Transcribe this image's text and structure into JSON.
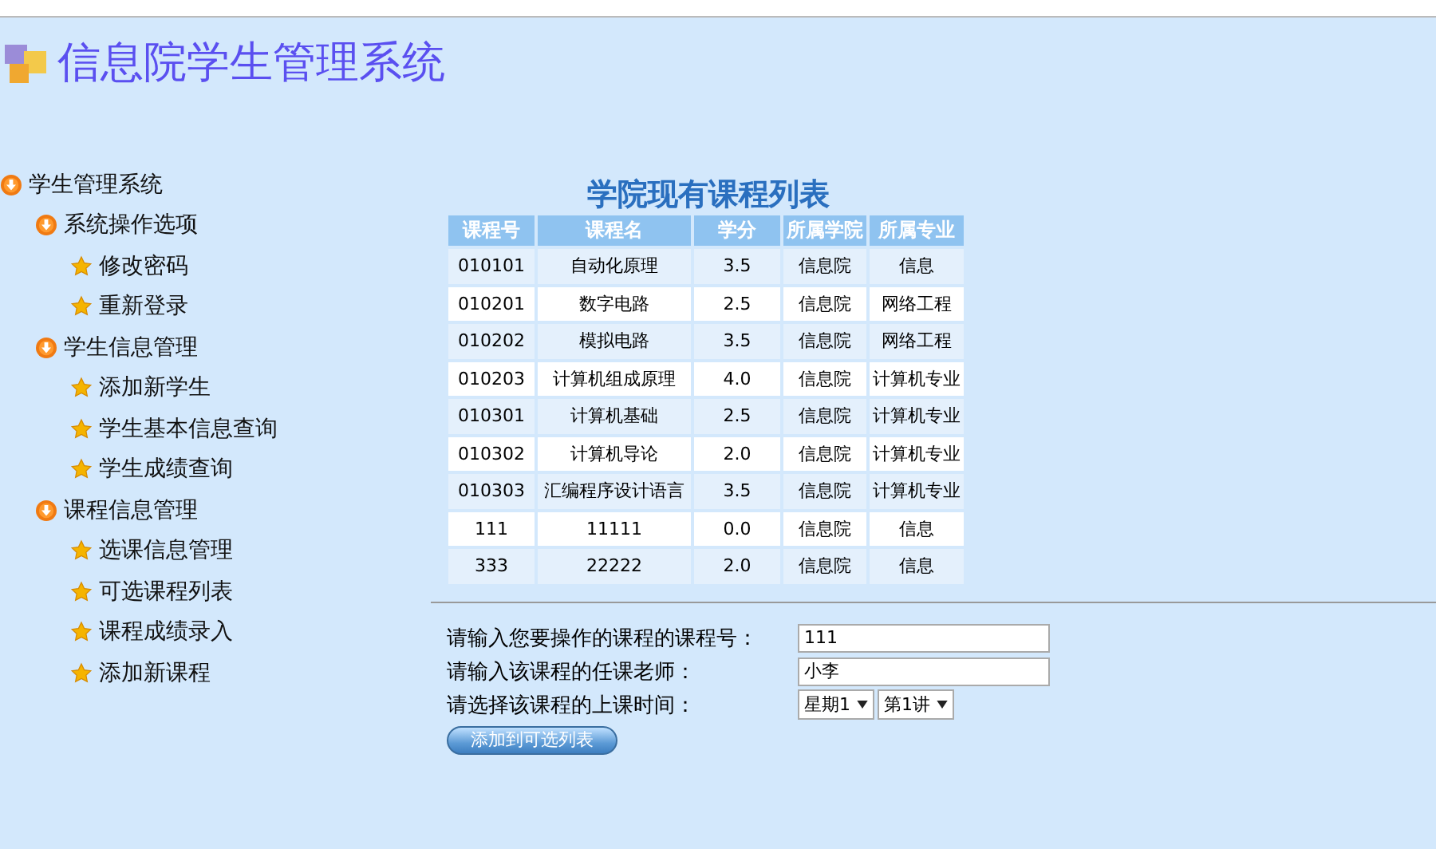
{
  "header": {
    "title": "信息院学生管理系统"
  },
  "nav": [
    {
      "label": "学生管理系统",
      "children": [
        {
          "label": "系统操作选项",
          "children": [
            {
              "label": "修改密码"
            },
            {
              "label": "重新登录"
            }
          ]
        },
        {
          "label": "学生信息管理",
          "children": [
            {
              "label": "添加新学生"
            },
            {
              "label": "学生基本信息查询"
            },
            {
              "label": "学生成绩查询"
            }
          ]
        },
        {
          "label": "课程信息管理",
          "children": [
            {
              "label": "选课信息管理"
            },
            {
              "label": "可选课程列表"
            },
            {
              "label": "课程成绩录入"
            },
            {
              "label": "添加新课程"
            }
          ]
        }
      ]
    }
  ],
  "table": {
    "title": "学院现有课程列表",
    "columns": [
      "课程号",
      "课程名",
      "学分",
      "所属学院",
      "所属专业"
    ],
    "rows": [
      [
        "010101",
        "自动化原理",
        "3.5",
        "信息院",
        "信息"
      ],
      [
        "010201",
        "数字电路",
        "2.5",
        "信息院",
        "网络工程"
      ],
      [
        "010202",
        "模拟电路",
        "3.5",
        "信息院",
        "网络工程"
      ],
      [
        "010203",
        "计算机组成原理",
        "4.0",
        "信息院",
        "计算机专业"
      ],
      [
        "010301",
        "计算机基础",
        "2.5",
        "信息院",
        "计算机专业"
      ],
      [
        "010302",
        "计算机导论",
        "2.0",
        "信息院",
        "计算机专业"
      ],
      [
        "010303",
        "汇编程序设计语言",
        "3.5",
        "信息院",
        "计算机专业"
      ],
      [
        "111",
        "11111",
        "0.0",
        "信息院",
        "信息"
      ],
      [
        "333",
        "22222",
        "2.0",
        "信息院",
        "信息"
      ]
    ]
  },
  "form": {
    "fields": [
      {
        "kind": "input",
        "label": "请输入您要操作的课程的课程号：",
        "value": "111"
      },
      {
        "kind": "input",
        "label": "请输入该课程的任课老师：",
        "value": "小李"
      },
      {
        "kind": "selects",
        "label": "请选择该课程的上课时间：",
        "values": [
          "星期1",
          "第1讲"
        ]
      }
    ],
    "button": "添加到可选列表"
  }
}
